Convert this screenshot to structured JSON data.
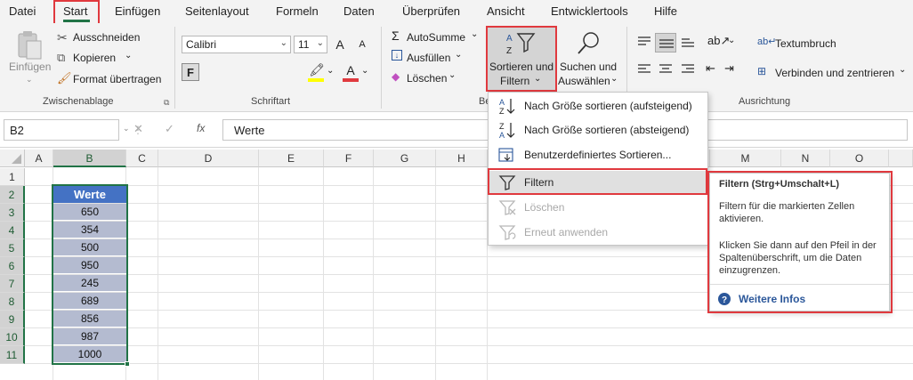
{
  "menu": [
    "Datei",
    "Start",
    "Einfügen",
    "Seitenlayout",
    "Formeln",
    "Daten",
    "Überprüfen",
    "Ansicht",
    "Entwicklertools",
    "Hilfe"
  ],
  "clipboard": {
    "paste": "Einfügen",
    "cut": "Ausschneiden",
    "copy": "Kopieren",
    "format_painter": "Format übertragen",
    "label": "Zwischenablage"
  },
  "font": {
    "name": "Calibri",
    "size": "11",
    "grow": "A",
    "shrink": "A",
    "bold": "F",
    "color_letter": "A",
    "label": "Schriftart"
  },
  "editing": {
    "autosum": "AutoSumme",
    "fill": "Ausfüllen",
    "clear": "Löschen",
    "sort_filter": [
      "Sortieren und",
      "Filtern"
    ],
    "find_select": [
      "Suchen und",
      "Auswählen"
    ],
    "label": "Be"
  },
  "alignment": {
    "wrap": "Textumbruch",
    "merge": "Verbinden und zentrieren",
    "label": "Ausrichtung"
  },
  "formula_bar": {
    "namebox": "B2",
    "cancel": "✕",
    "enter": "✓",
    "fx": "fx",
    "value": "Werte"
  },
  "columns": [
    "A",
    "B",
    "C",
    "D",
    "E",
    "F",
    "G",
    "H",
    "M",
    "N",
    "O"
  ],
  "rows": [
    "1",
    "2",
    "3",
    "4",
    "5",
    "6",
    "7",
    "8",
    "9",
    "10",
    "11"
  ],
  "table": {
    "header": "Werte",
    "values": [
      "650",
      "354",
      "500",
      "950",
      "245",
      "689",
      "856",
      "987",
      "1000"
    ]
  },
  "dropdown": {
    "items": [
      {
        "label": "Nach Größe sortieren (aufsteigend)"
      },
      {
        "label": "Nach Größe sortieren (absteigend)"
      },
      {
        "label": "Benutzerdefiniertes Sortieren..."
      },
      {
        "label": "Filtern"
      },
      {
        "label": "Löschen"
      },
      {
        "label": "Erneut anwenden"
      }
    ]
  },
  "tooltip": {
    "title": "Filtern (Strg+Umschalt+L)",
    "desc": "Filtern für die markierten Zellen aktivieren.",
    "detail": "Klicken Sie dann auf den Pfeil in der Spaltenüberschrift, um die Daten einzugrenzen.",
    "link": "Weitere Infos"
  },
  "colors": {
    "accent_green": "#217346",
    "highlight_red": "#e0393e",
    "table_header": "#4472c4",
    "table_cell": "#b4bbd0",
    "link_blue": "#2b579a"
  }
}
